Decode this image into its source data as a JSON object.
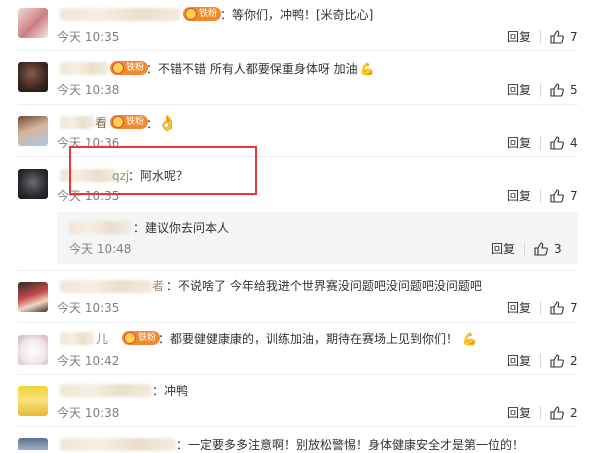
{
  "comments": [
    {
      "badge": "铁粉",
      "text": "：等你们，冲鸭！[米奇比心]",
      "time": "今天 10:35",
      "reply": "回复",
      "likes": "7"
    },
    {
      "badge": "铁粉",
      "text": "：不错不错 所有人都要保重身体呀 加油",
      "time": "今天 10:38",
      "reply": "回复",
      "likes": "5"
    },
    {
      "badge": "铁粉",
      "text": "：",
      "time": "今天 10:36",
      "reply": "回复",
      "likes": "4",
      "name_fragment": "看"
    },
    {
      "text": "：阿水呢？",
      "time": "今天 10:35",
      "reply": "回复",
      "likes": "7",
      "name_fragment": "qzj"
    },
    {
      "text": "：建议你去问本人",
      "time": "今天 10:48",
      "reply": "回复",
      "likes": "3"
    },
    {
      "text": "：不说啥了 今年给我进个世界赛没问题吧没问题吧没问题吧",
      "time": "今天 10:35",
      "reply": "回复",
      "likes": "7",
      "name_fragment": "者"
    },
    {
      "badge": "铁粉",
      "text": "：都要健健康康的，训练加油，期待在赛场上见到你们！",
      "time": "今天 10:42",
      "reply": "回复",
      "likes": "2",
      "name_fragment": "儿"
    },
    {
      "text": "：冲鸭",
      "time": "今天 10:38",
      "reply": "回复",
      "likes": "2"
    },
    {
      "text": "：一定要多多注意啊！别放松警惕！身体健康安全才是第一位的！"
    }
  ],
  "colors": {
    "badge": "#f08a2c",
    "highlight": "#e53935",
    "reply_bg": "#f5f5f5"
  }
}
